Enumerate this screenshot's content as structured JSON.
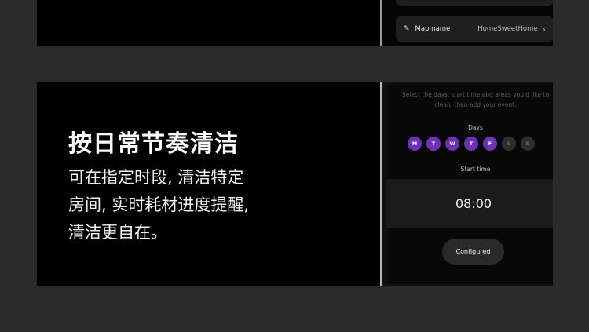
{
  "top_panel": {
    "map_name_label": "Map name",
    "map_name_value": "HomeSweetHome"
  },
  "feature": {
    "heading": "按日常节奏清洁",
    "desc_lines": [
      "可在指定时段, 清洁特定",
      "房间, 实时耗材进度提醒,",
      "清洁更自在。"
    ]
  },
  "schedule": {
    "instruction_line1": "Select the days, start time and areas you'd like to",
    "instruction_line2": "clean, then add your event.",
    "days_label": "Days",
    "days": [
      {
        "letter": "M",
        "selected": true
      },
      {
        "letter": "T",
        "selected": true
      },
      {
        "letter": "W",
        "selected": true
      },
      {
        "letter": "T",
        "selected": true
      },
      {
        "letter": "F",
        "selected": true
      },
      {
        "letter": "S",
        "selected": false
      },
      {
        "letter": "S",
        "selected": false
      }
    ],
    "start_time_label": "Start time",
    "start_time": "08:00",
    "configured_button": "Configured"
  },
  "colors": {
    "accent_purple": "#6b32b8",
    "page_background": "#2a2a2a",
    "panel_background": "#000000"
  }
}
